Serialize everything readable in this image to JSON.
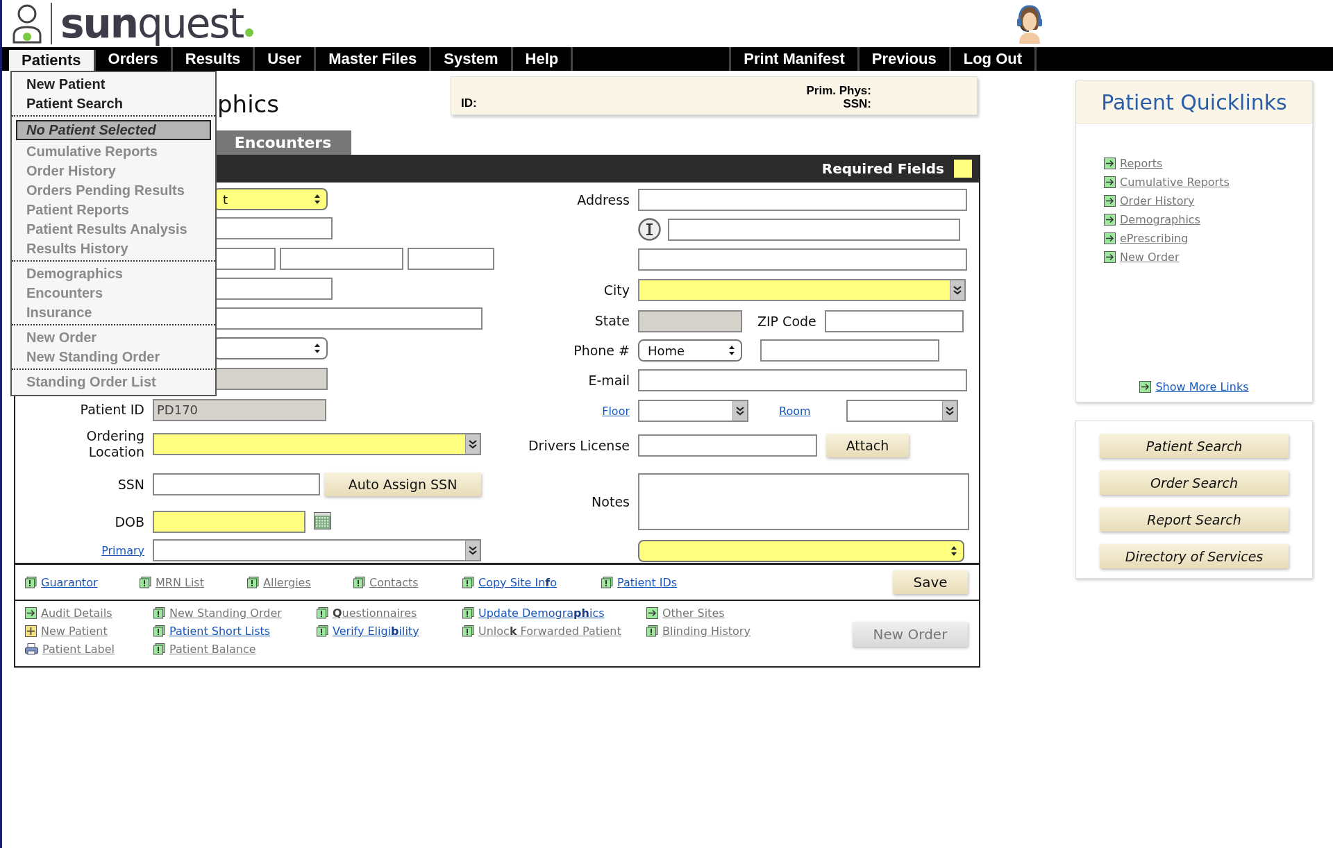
{
  "logo": {
    "text": "**sun**quest"
  },
  "nav": {
    "left": [
      {
        "label": "Patients",
        "selected": true
      },
      {
        "label": "Orders",
        "selected": false
      },
      {
        "label": "Results",
        "selected": false
      },
      {
        "label": "User",
        "selected": false
      },
      {
        "label": "Master Files",
        "selected": false
      },
      {
        "label": "System",
        "selected": false
      },
      {
        "label": "Help",
        "selected": false
      }
    ],
    "right": [
      "Print Manifest",
      "Previous",
      "Log Out"
    ]
  },
  "patients_menu": [
    [
      {
        "label": "New Patient",
        "kind": "item",
        "disabled": false
      },
      {
        "label": "Patient Search",
        "kind": "item",
        "disabled": false
      }
    ],
    [
      {
        "label": "No Patient Selected",
        "kind": "status"
      },
      {
        "label": "Cumulative Reports",
        "kind": "item",
        "disabled": true
      },
      {
        "label": "Order History",
        "kind": "item",
        "disabled": true
      },
      {
        "label": "Orders Pending Results",
        "kind": "item",
        "disabled": true
      },
      {
        "label": "Patient Reports",
        "kind": "item",
        "disabled": true
      },
      {
        "label": "Patient Results Analysis",
        "kind": "item",
        "disabled": true
      },
      {
        "label": "Results History",
        "kind": "item",
        "disabled": true
      }
    ],
    [
      {
        "label": "Demographics",
        "kind": "item",
        "disabled": true
      },
      {
        "label": "Encounters",
        "kind": "item",
        "disabled": true
      },
      {
        "label": "Insurance",
        "kind": "item",
        "disabled": true
      }
    ],
    [
      {
        "label": "New Order",
        "kind": "item",
        "disabled": true
      },
      {
        "label": "New Standing Order",
        "kind": "item",
        "disabled": true
      }
    ],
    [
      {
        "label": "Standing Order List",
        "kind": "item",
        "disabled": true
      }
    ]
  ],
  "page_title": "phics",
  "patient_header": {
    "id_label": "ID:",
    "prim_phys_label": "Prim. Phys:",
    "ssn_label": "SSN:"
  },
  "tabs": [
    {
      "label": "Encounters",
      "selected": false
    }
  ],
  "form": {
    "legend": "Required Fields",
    "left_rows": [
      {
        "fields": [
          {
            "kind": "select",
            "value": "t",
            "required": true
          }
        ]
      },
      {
        "fields": [
          {
            "kind": "text",
            "required": false
          }
        ]
      },
      {
        "fields": [
          {
            "kind": "text",
            "required": false
          },
          {
            "kind": "text",
            "required": false
          },
          {
            "kind": "text",
            "required": false
          }
        ]
      },
      {
        "fields": [
          {
            "kind": "text",
            "required": false
          }
        ]
      },
      {
        "fields": [
          {
            "kind": "text",
            "required": false
          }
        ]
      },
      {
        "fields": [
          {
            "kind": "select",
            "required": false
          }
        ]
      },
      {
        "fields": [
          {
            "kind": "readonly"
          }
        ]
      },
      {
        "label": "Patient ID",
        "fields": [
          {
            "kind": "readonly",
            "value": "PD170"
          }
        ]
      },
      {
        "label": "Ordering Location",
        "fields": [
          {
            "kind": "combo",
            "required": true
          }
        ]
      },
      {
        "label": "SSN",
        "fields": [
          {
            "kind": "text",
            "required": false
          },
          {
            "kind": "button",
            "label": "Auto Assign SSN"
          }
        ]
      },
      {
        "label": "DOB",
        "fields": [
          {
            "kind": "text",
            "required": true
          },
          {
            "kind": "calendar"
          }
        ]
      },
      {
        "link": "Primary",
        "fields": [
          {
            "kind": "combo",
            "required": false
          }
        ]
      }
    ],
    "right_rows": [
      {
        "label": "Address",
        "fields": [
          {
            "kind": "text",
            "required": false
          }
        ]
      },
      {
        "fields": [
          {
            "kind": "info"
          },
          {
            "kind": "text",
            "required": false
          }
        ]
      },
      {
        "fields": [
          {
            "kind": "text",
            "required": false
          }
        ]
      },
      {
        "label": "City",
        "fields": [
          {
            "kind": "combo",
            "required": true
          }
        ]
      },
      {
        "label": "State",
        "fields": [
          {
            "kind": "readonly"
          },
          {
            "kind": "label",
            "text": "ZIP Code"
          },
          {
            "kind": "text",
            "required": false
          }
        ]
      },
      {
        "label": "Phone #",
        "fields": [
          {
            "kind": "select",
            "value": "Home",
            "required": false
          },
          {
            "kind": "text",
            "required": false
          }
        ]
      },
      {
        "label": "E-mail",
        "fields": [
          {
            "kind": "text",
            "required": false
          }
        ]
      },
      {
        "link": "Floor",
        "fields": [
          {
            "kind": "combo",
            "required": false
          },
          {
            "kind": "link",
            "text": "Room"
          },
          {
            "kind": "combo",
            "required": false
          }
        ]
      },
      {
        "label": "Drivers License",
        "fields": [
          {
            "kind": "text",
            "required": false
          },
          {
            "kind": "button",
            "label": "Attach"
          }
        ]
      },
      {
        "label": "Notes",
        "fields": [
          {
            "kind": "textarea"
          }
        ]
      },
      {
        "fields": [
          {
            "kind": "select",
            "required": true
          }
        ]
      }
    ]
  },
  "action_links": [
    {
      "label": "Guarantor",
      "kind": "alert",
      "enabled": true
    },
    {
      "label": "MRN List",
      "kind": "alert",
      "enabled": false
    },
    {
      "label": "Allergies",
      "kind": "alert",
      "enabled": false
    },
    {
      "label": "Contacts",
      "kind": "alert",
      "enabled": false
    },
    {
      "label": "Copy Site In**f**o",
      "kind": "alert",
      "enabled": true
    },
    {
      "label": "Patient IDs",
      "kind": "alert",
      "enabled": true
    }
  ],
  "save_button": "Save",
  "more_links": [
    [
      {
        "label": "Audit Details",
        "kind": "arrow",
        "enabled": false
      },
      {
        "label": "New Patient",
        "kind": "plus",
        "enabled": false
      },
      {
        "label": "Patient Label",
        "kind": "printer",
        "enabled": false
      }
    ],
    [
      {
        "label": "New Standing Order",
        "kind": "alert",
        "enabled": false
      },
      {
        "label": "Patient Short Lists",
        "kind": "alert",
        "enabled": true
      },
      {
        "label": "Patient Balance",
        "kind": "alert",
        "enabled": false
      }
    ],
    [
      {
        "label": "**Q**uestionnaires",
        "kind": "alert",
        "enabled": false
      },
      {
        "label": "Verify Eligi**b**ility",
        "kind": "alert",
        "enabled": true
      }
    ],
    [
      {
        "label": "Update Demogra**ph**ics",
        "kind": "alert",
        "enabled": true
      },
      {
        "label": "Unloc**k** Forwarded Patient",
        "kind": "alert",
        "enabled": false
      }
    ],
    [
      {
        "label": "Other Sites",
        "kind": "arrow",
        "enabled": false
      },
      {
        "label": "Blinding History",
        "kind": "alert",
        "enabled": false
      }
    ]
  ],
  "new_order_button": {
    "label": "New Order",
    "disabled": true
  },
  "quicklinks": {
    "title": "Patient Quicklinks",
    "links": [
      "Reports",
      "Cumulative Reports",
      "Order History",
      "Demographics",
      "ePrescribing",
      "New Order"
    ],
    "more": "Show More Links"
  },
  "search_buttons": [
    "Patient Search",
    "Order Search",
    "Report Search",
    "Directory of Services"
  ]
}
